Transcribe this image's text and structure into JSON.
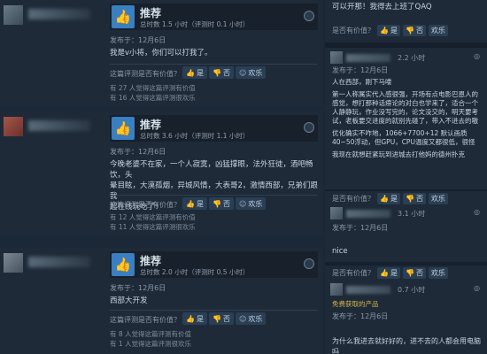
{
  "reviews": [
    {
      "title": "推荐",
      "hours": "总时数 1.5 小时（评测时 0.1 小时）",
      "posted": "发布于：12月6日",
      "body": [
        "我是v小将，你们可以打我了。"
      ],
      "helpful_question": "这篇评测是否有价值？",
      "yes": "是",
      "no": "否",
      "funny": "欢乐",
      "stats": [
        "有 27 人觉得这篇评测有价值",
        "有 16 人觉得这篇评测很欢乐"
      ]
    },
    {
      "title": "推荐",
      "hours": "总时数 3.6 小时（评测时 1.1 小时）",
      "posted": "发布于：12月6日",
      "body": [
        "今晚老婆不在家，一个人寂寞，凶猛撑眼，法外狂徒，酒吧畅饮，头",
        "晕目眩，大漠孤烟，异城风情，大表哥2，激情西部，兄弟们跟我一",
        "起在线玩吃了！"
      ],
      "helpful_question": "这篇评测是否有价值？",
      "yes": "是",
      "no": "否",
      "funny": "欢乐",
      "stats": [
        "有 12 人觉得这篇评测有价值",
        "有 11 人觉得这篇评测很欢乐"
      ]
    },
    {
      "title": "推荐",
      "hours": "总时数 2.0 小时（评测时 0.5 小时）",
      "posted": "发布于：12月6日",
      "body": [
        "西部大开发"
      ],
      "helpful_question": "这篇评测是否有价值？",
      "yes": "是",
      "no": "否",
      "funny": "欢乐",
      "stats": [
        "有 8 人觉得这篇评测有价值",
        "有 1 人觉得这篇评测很欢乐"
      ]
    }
  ],
  "right": {
    "top_text": "可以开那！我得去上班了QAQ",
    "helpful_question": "是否有价值？",
    "yes": "是",
    "no": "否",
    "funny": "欢乐",
    "c1_time": "2.2 小时",
    "c1_posted": "发布于：12月6日",
    "c1_body": [
      "人在西部，刚下马喽",
      "",
      "第一人称属实代入感很强，开场有点电影巴恩人的",
      "感觉，想打那种话痨论的对白也学来了，适合一个",
      "人静静玩，作业没写完的，论文没交的，明天要考",
      "试，老板要交进度的就别先碰了，带入不进去的嗷",
      "",
      "优化确实不咋地，1066+7700+12 默认画质",
      "40~50浮动，但GPU，CPU温度又都很低，很怪",
      "",
      "我现在就想赶紧玩到进城去打他妈的德州扑克"
    ],
    "c2_time": "3.1 小时",
    "c2_posted": "发布于：12月6日",
    "c2_body": "nice",
    "c3_time": "0.7 小时",
    "c3_free": "免费获取的产品",
    "c3_posted": "发布于：12月6日",
    "c3_body": "为什么我进去就好好的，进不去的人都会用电脑吗"
  }
}
